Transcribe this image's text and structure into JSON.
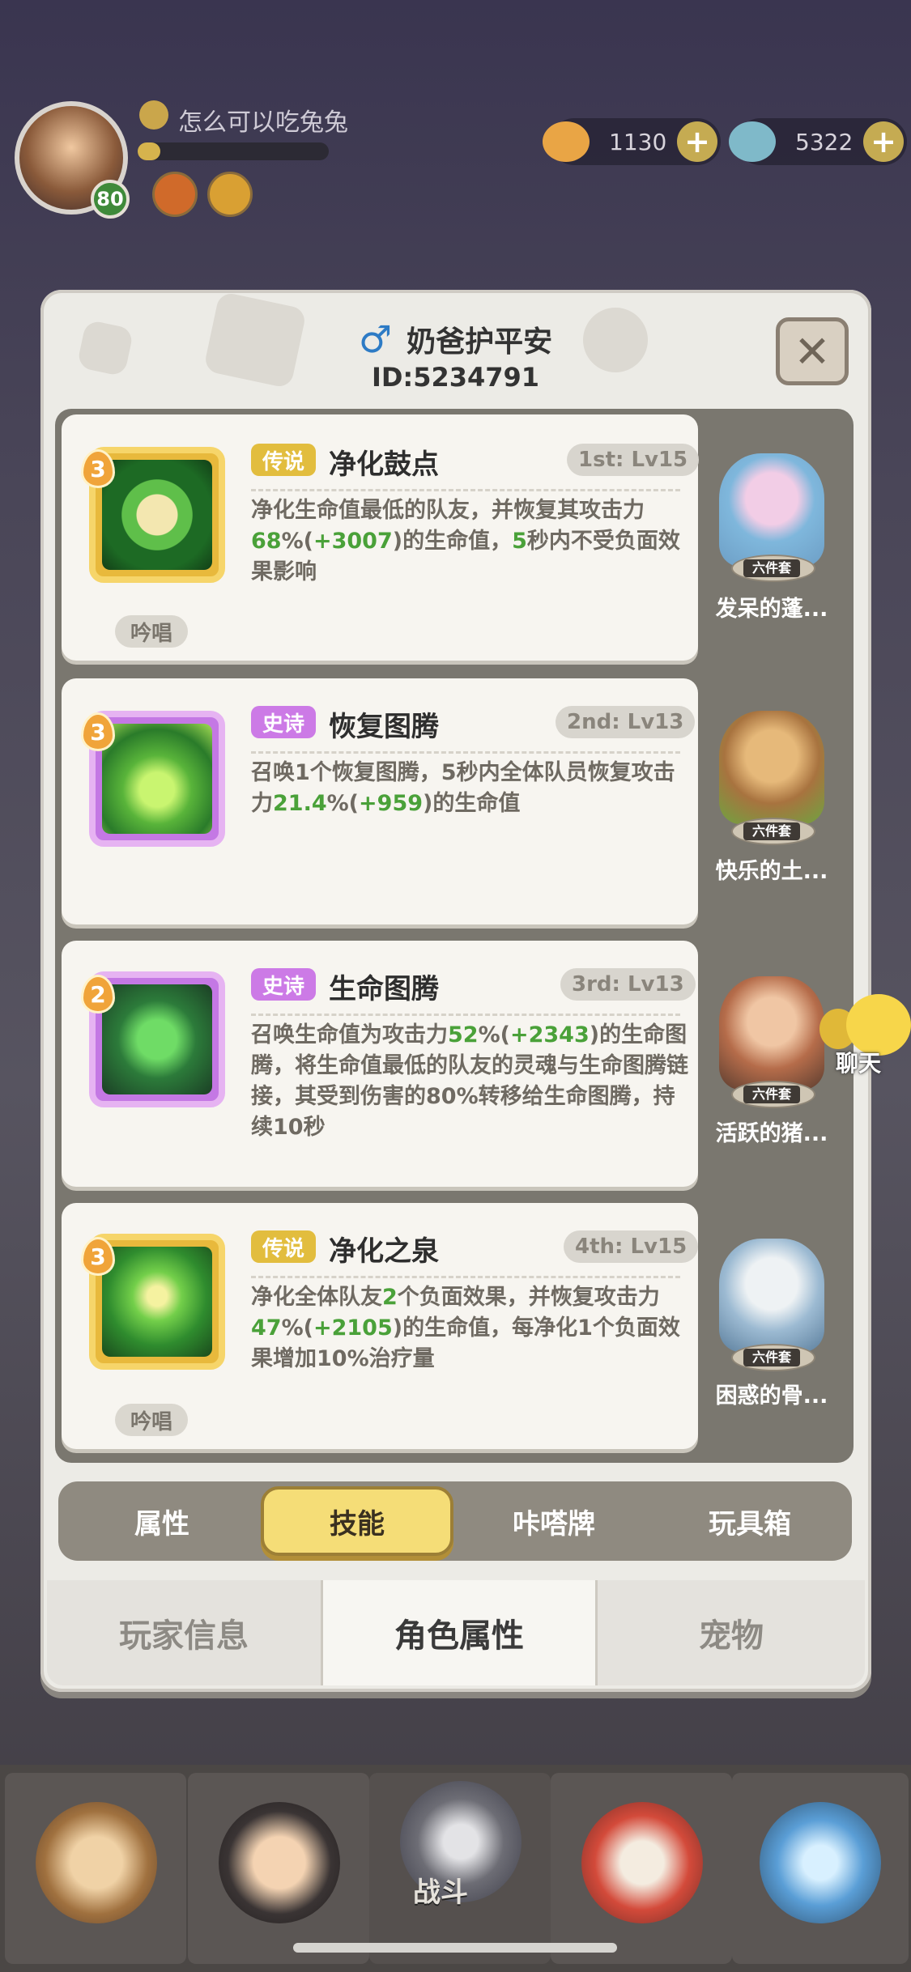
{
  "hud": {
    "player_name": "怎么可以吃兔兔",
    "avatar_level": "80",
    "currency_1": "1130",
    "currency_2": "5322",
    "plus": "+"
  },
  "dialog": {
    "gender_symbol": "♂",
    "player_nickname": "奶爸护平安",
    "player_id": "ID:5234791",
    "close_symbol": "✕"
  },
  "skills": [
    {
      "level_badge": "3",
      "tier": "传说",
      "name": "净化鼓点",
      "rank": "1st: Lv15",
      "desc_parts": [
        "净化生命值最低的队友，并恢复其攻击力",
        "68",
        "%(",
        "+3007",
        ")的生命值，",
        "5",
        "秒内不受负面效果影响"
      ],
      "chant": "吟唱",
      "set_tag": "六件套",
      "set_name": "发呆的蓬..."
    },
    {
      "level_badge": "3",
      "tier": "史诗",
      "name": "恢复图腾",
      "rank": "2nd: Lv13",
      "desc_parts": [
        "召唤1个恢复图腾，5秒内全体队员恢复攻击力",
        "21.4",
        "%(",
        "+959",
        ")的生命值"
      ],
      "chant": "",
      "set_tag": "六件套",
      "set_name": "快乐的土..."
    },
    {
      "level_badge": "2",
      "tier": "史诗",
      "name": "生命图腾",
      "rank": "3rd: Lv13",
      "desc_parts": [
        "召唤生命值为攻击力",
        "52",
        "%(",
        "+2343",
        ")的生命图腾，将生命值最低的队友的灵魂与生命图腾链接，其受到伤害的80%转移给生命图腾，持续10秒"
      ],
      "chant": "",
      "set_tag": "六件套",
      "set_name": "活跃的猪..."
    },
    {
      "level_badge": "3",
      "tier": "传说",
      "name": "净化之泉",
      "rank": "4th: Lv15",
      "desc_parts": [
        "净化全体队友",
        "2",
        "个负面效果，并恢复攻击力",
        "47",
        "%(",
        "+2105",
        ")的生命值，每净化1个负面效果增加10%治疗量"
      ],
      "chant": "吟唱",
      "set_tag": "六件套",
      "set_name": "困惑的骨..."
    }
  ],
  "segment_tabs": [
    "属性",
    "技能",
    "咔嗒牌",
    "玩具箱"
  ],
  "bottom_tabs": [
    "玩家信息",
    "角色属性",
    "宠物"
  ],
  "chat_label": "聊天",
  "nav": {
    "battle_label": "战斗"
  },
  "colors": {
    "legend": "#e2bd3e",
    "epic": "#cc7ae6",
    "highlight_green": "#4aa139",
    "active_tab": "#f5dd77"
  }
}
